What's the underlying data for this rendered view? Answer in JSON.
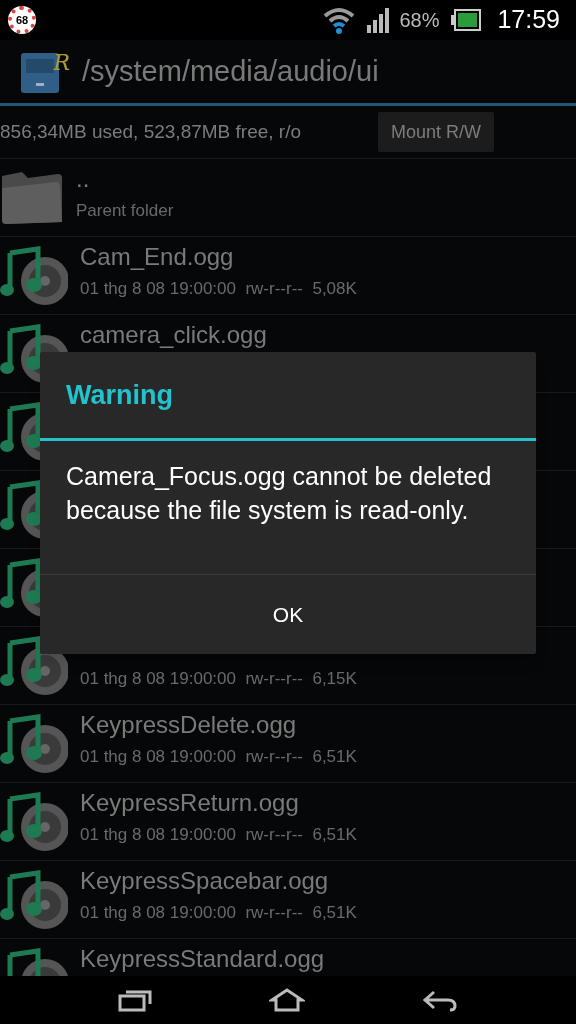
{
  "status_bar": {
    "badge": "68",
    "battery": "68%",
    "time": "17:59"
  },
  "action_bar": {
    "icon_letter": "R",
    "path": "/system/media/audio/ui"
  },
  "storage": {
    "info": "856,34MB used, 523,87MB free, r/o",
    "button": "Mount R/W"
  },
  "files": [
    {
      "kind": "folder",
      "name": "..",
      "meta": "Parent folder"
    },
    {
      "kind": "audio",
      "name": "Cam_End.ogg",
      "meta": "01 thg 8 08 19:00:00  rw-r--r--  5,08K"
    },
    {
      "kind": "audio",
      "name": "camera_click.ogg"
    },
    {
      "kind": "audio"
    },
    {
      "kind": "audio"
    },
    {
      "kind": "audio"
    },
    {
      "kind": "audio",
      "meta": "01 thg 8 08 19:00:00  rw-r--r--  6,15K"
    },
    {
      "kind": "audio",
      "name": "KeypressDelete.ogg",
      "meta": "01 thg 8 08 19:00:00  rw-r--r--  6,51K"
    },
    {
      "kind": "audio",
      "name": "KeypressReturn.ogg",
      "meta": "01 thg 8 08 19:00:00  rw-r--r--  6,51K"
    },
    {
      "kind": "audio",
      "name": "KeypressSpacebar.ogg",
      "meta": "01 thg 8 08 19:00:00  rw-r--r--  6,51K"
    },
    {
      "kind": "audio",
      "name": "KeypressStandard.ogg"
    }
  ],
  "dialog": {
    "title": "Warning",
    "message": "Camera_Focus.ogg cannot be deleted because the file system is read-only.",
    "button": "OK"
  }
}
